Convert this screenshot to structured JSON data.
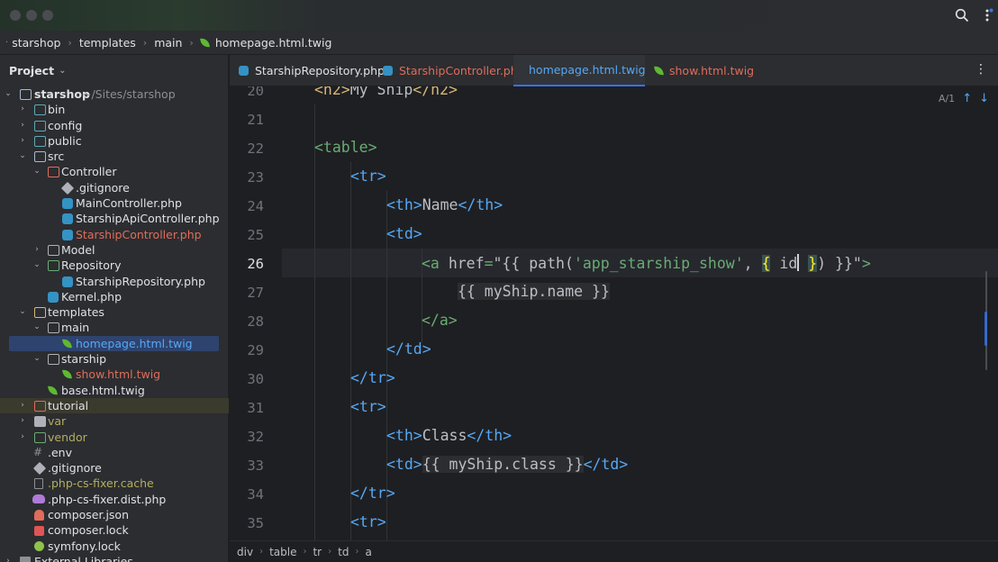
{
  "window": {
    "search_icon": "search-icon",
    "more_icon": "kebab-menu-icon"
  },
  "breadcrumb": {
    "items": [
      "starshop",
      "templates",
      "main",
      "homepage.html.twig"
    ]
  },
  "project": {
    "title": "Project",
    "tree": [
      {
        "label": "starshop",
        "extra": "~/Sites/starshop"
      },
      {
        "label": "bin"
      },
      {
        "label": "config"
      },
      {
        "label": "public"
      },
      {
        "label": "src"
      },
      {
        "label": "Controller"
      },
      {
        "label": ".gitignore"
      },
      {
        "label": "MainController.php"
      },
      {
        "label": "StarshipApiController.php"
      },
      {
        "label": "StarshipController.php"
      },
      {
        "label": "Model"
      },
      {
        "label": "Repository"
      },
      {
        "label": "StarshipRepository.php"
      },
      {
        "label": "Kernel.php"
      },
      {
        "label": "templates"
      },
      {
        "label": "main"
      },
      {
        "label": "homepage.html.twig"
      },
      {
        "label": "starship"
      },
      {
        "label": "show.html.twig"
      },
      {
        "label": "base.html.twig"
      },
      {
        "label": "tutorial"
      },
      {
        "label": "var"
      },
      {
        "label": "vendor"
      },
      {
        "label": ".env"
      },
      {
        "label": ".gitignore"
      },
      {
        "label": ".php-cs-fixer.cache"
      },
      {
        "label": ".php-cs-fixer.dist.php"
      },
      {
        "label": "composer.json"
      },
      {
        "label": "composer.lock"
      },
      {
        "label": "symfony.lock"
      },
      {
        "label": "External Libraries"
      }
    ]
  },
  "tabs": [
    {
      "label": "StarshipRepository.php"
    },
    {
      "label": "StarshipController.php"
    },
    {
      "label": "homepage.html.twig"
    },
    {
      "label": "show.html.twig"
    }
  ],
  "editor": {
    "inspection": "A/1",
    "lines": [
      {
        "n": "20"
      },
      {
        "n": "21"
      },
      {
        "n": "22"
      },
      {
        "n": "23"
      },
      {
        "n": "24"
      },
      {
        "n": "25"
      },
      {
        "n": "26"
      },
      {
        "n": "27"
      },
      {
        "n": "28"
      },
      {
        "n": "29"
      },
      {
        "n": "30"
      },
      {
        "n": "31"
      },
      {
        "n": "32"
      },
      {
        "n": "33"
      },
      {
        "n": "34"
      },
      {
        "n": "35"
      }
    ],
    "code": {
      "l20_text": "My Ship",
      "l24_text": "Name",
      "l26_attr": "href",
      "l26_open": "\"{{ path(",
      "l26_route": "'app_starship_show'",
      "l26_comma": ", ",
      "l26_brace_open": "{",
      "l26_key": " id",
      "l26_brace_close": "}",
      "l26_close": ") }}\"",
      "l27_expr": "{{ myShip.name }}",
      "l32_text": "Class",
      "l33_expr": "{{ myShip.class }}"
    }
  },
  "bottom_breadcrumb": {
    "items": [
      "div",
      "table",
      "tr",
      "td",
      "a"
    ]
  }
}
